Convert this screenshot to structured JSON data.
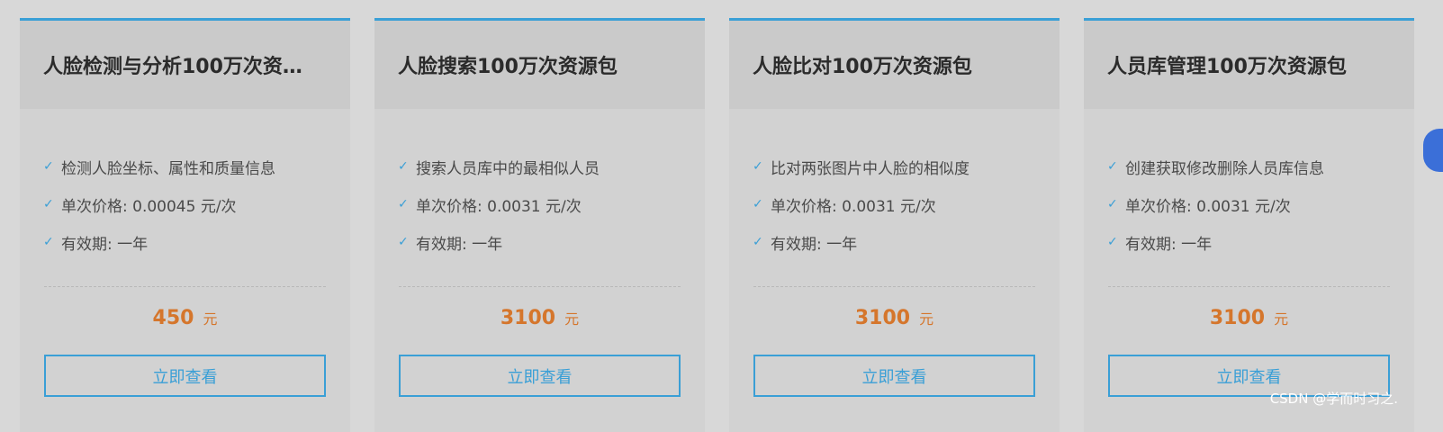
{
  "cards": [
    {
      "title": "人脸检测与分析100万次资…",
      "features": [
        "检测人脸坐标、属性和质量信息",
        "单次价格: 0.00045 元/次",
        "有效期: 一年"
      ],
      "price": "450",
      "unit": "元",
      "button": "立即查看"
    },
    {
      "title": "人脸搜索100万次资源包",
      "features": [
        "搜索人员库中的最相似人员",
        "单次价格: 0.0031 元/次",
        "有效期: 一年"
      ],
      "price": "3100",
      "unit": "元",
      "button": "立即查看"
    },
    {
      "title": "人脸比对100万次资源包",
      "features": [
        "比对两张图片中人脸的相似度",
        "单次价格: 0.0031 元/次",
        "有效期: 一年"
      ],
      "price": "3100",
      "unit": "元",
      "button": "立即查看"
    },
    {
      "title": "人员库管理100万次资源包",
      "features": [
        "创建获取修改删除人员库信息",
        "单次价格: 0.0031 元/次",
        "有效期: 一年"
      ],
      "price": "3100",
      "unit": "元",
      "button": "立即查看"
    }
  ],
  "watermark": "CSDN @学而时习之.",
  "colors": {
    "accent": "#3a9fd6",
    "price": "#d5762c",
    "widget": "#3b6fd8"
  },
  "icons": {
    "feature": "check-icon",
    "side": "floating-help-icon"
  }
}
